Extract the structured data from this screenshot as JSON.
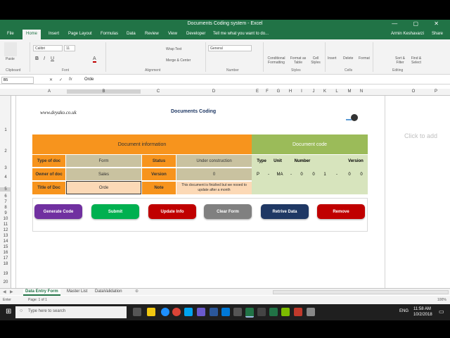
{
  "window": {
    "title": "Documents Coding system - Excel",
    "controls": "—  ▢  ✕"
  },
  "ribbon_tabs": [
    "File",
    "Home",
    "Insert",
    "Page Layout",
    "Formulas",
    "Data",
    "Review",
    "View",
    "Developer",
    "Tell me what you want to do..."
  ],
  "user": "Armin Keshavarzi",
  "share": "Share",
  "ribbon": {
    "paste": "Paste",
    "clipboard": "Clipboard",
    "font_name": "Calibri",
    "font_size": "11",
    "font_group": "Font",
    "wrap_text": "Wrap Text",
    "merge_center": "Merge & Center",
    "alignment": "Alignment",
    "number_format": "General",
    "number": "Number",
    "cond_format": "Conditional Formatting",
    "format_table": "Format as Table",
    "cell_styles": "Cell Styles",
    "styles": "Styles",
    "insert": "Insert",
    "delete": "Delete",
    "format": "Format",
    "cells": "Cells",
    "sort_filter": "Sort & Filter",
    "find_select": "Find & Select",
    "editing": "Editing"
  },
  "formula_bar": {
    "name_box": "B5",
    "value": "Orde"
  },
  "columns": [
    "A",
    "B",
    "C",
    "D",
    "E",
    "F",
    "G",
    "H",
    "I",
    "J",
    "K",
    "L",
    "M",
    "N",
    "O",
    "P"
  ],
  "rows": [
    "1",
    "2",
    "3",
    "4",
    "5",
    "6",
    "7",
    "8",
    "9",
    "10",
    "11",
    "12",
    "13",
    "14",
    "15",
    "16",
    "17",
    "18",
    "19",
    "20"
  ],
  "sheet": {
    "website": "www.deyako.co.uk",
    "title": "Documents Coding",
    "doc_info_header": "Document information",
    "doc_code_header": "Document code",
    "labels": {
      "type_of_doc": "Type of doc",
      "owner_of_doc": "Owner of doc",
      "title_of_doc": "Title of Doc",
      "status": "Status",
      "version": "Version",
      "note": "Note"
    },
    "values": {
      "type": "Form",
      "owner": "Sales",
      "title": "Orde",
      "status": "Under construction",
      "version": "0",
      "note": "This document is finizlied but we nooed to update after a month"
    },
    "code_headers": {
      "type": "Type",
      "unit": "Unit",
      "number": "Number",
      "version": "Version"
    },
    "code_values": [
      "P",
      "-",
      "MA",
      "-",
      "0",
      "0",
      "1",
      "-",
      "0",
      "0"
    ],
    "buttons": {
      "generate": "Generate Code",
      "submit": "Submit",
      "update": "Update Info",
      "clear": "Clear Form",
      "retrieve": "Retrive Data",
      "remove": "Remove"
    }
  },
  "right_pane": "Click to add",
  "sheet_tabs": [
    "Data Entry Form",
    "Master List",
    "DataValidation"
  ],
  "status_bar": {
    "mode": "Enter",
    "page": "Page: 1 of 1",
    "zoom": "100%"
  },
  "taskbar": {
    "search_placeholder": "Type here to search",
    "time": "11:58 AM",
    "date": "10/2/2018",
    "lang": "ENG"
  },
  "colors": {
    "excel_green": "#217346",
    "orange": "#f7941d",
    "tan": "#c9c2a0",
    "green": "#9bbb59",
    "btn_purple": "#7030a0",
    "btn_green": "#00b050",
    "btn_red": "#c00000",
    "btn_gray": "#808080",
    "btn_navy": "#1f3864"
  }
}
